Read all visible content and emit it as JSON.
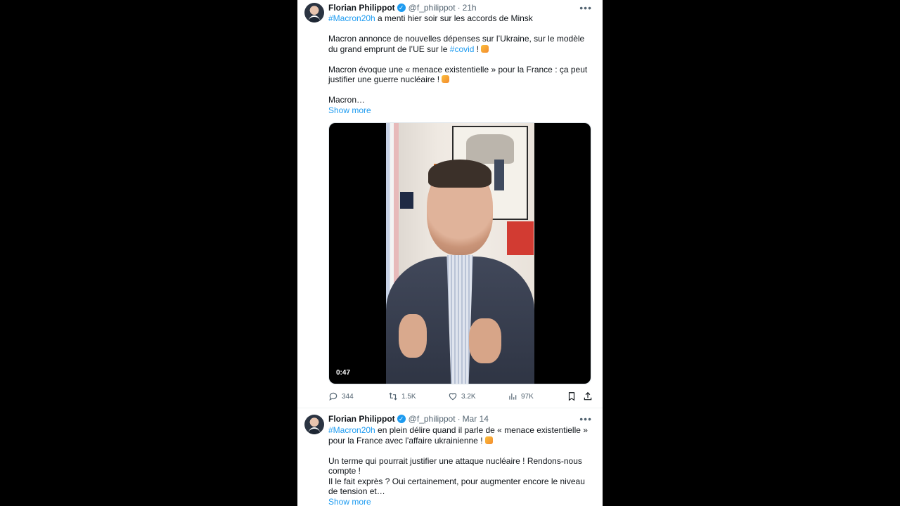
{
  "tweets": [
    {
      "author": "Florian Philippot",
      "handle": "@f_philippot",
      "separator": "·",
      "time": "21h",
      "hashtag1": "#Macron20h",
      "line1": " a menti hier soir sur les accords de Minsk",
      "p2a": "Macron annonce de nouvelles dépenses sur l’Ukraine, sur le modèle du grand emprunt de l’UE sur le ",
      "hashtag2": "#covid",
      "p2b": " ! ",
      "p3": "Macron évoque une « menace existentielle » pour la France : ça peut justifier une guerre nucléaire ! ",
      "p4": "Macron…",
      "show_more": "Show more",
      "video_duration": "0:47",
      "replies": "344",
      "reposts": "1.5K",
      "likes": "3.2K",
      "views": "97K"
    },
    {
      "author": "Florian Philippot",
      "handle": "@f_philippot",
      "separator": "·",
      "time": "Mar 14",
      "hashtag1": "#Macron20h",
      "p1": " en plein délire quand il parle de « menace existentielle » pour la France avec l'affaire ukrainienne ! ",
      "p2": "Un terme qui pourrait justifier une attaque nucléaire ! Rendons-nous compte !",
      "p3": "Il le fait exprès ? Oui certainement, pour augmenter encore le niveau de tension et…",
      "show_more": "Show more"
    }
  ],
  "icons": {
    "verified": "verified-badge-icon",
    "more": "more-icon",
    "reply": "reply-icon",
    "repost": "repost-icon",
    "like": "heart-icon",
    "views": "views-icon",
    "bookmark": "bookmark-icon",
    "share": "share-icon",
    "emoji": "facepalm-emoji"
  },
  "colors": {
    "accent": "#1d9bf0",
    "text": "#0f1419",
    "muted": "#536471"
  }
}
